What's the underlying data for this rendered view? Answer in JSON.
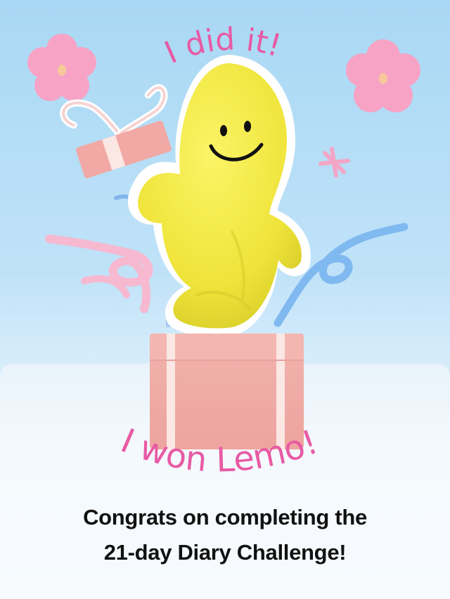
{
  "celebration": {
    "top_text": "I did it!",
    "bottom_text": "I won Lemo!",
    "caption_line1": "Congrats on completing the",
    "caption_line2": "21-day Diary Challenge!"
  },
  "colors": {
    "sky": "#b8def6",
    "panel": "#f4f9fd",
    "flower": "#f7a3c6",
    "flower_center": "#f6c89a",
    "gift_box": "#f2a8a4",
    "ribbon": "#fbe7e3",
    "lemo_body": "#f3ea3f",
    "hand_text": "#e85aa4",
    "caption_text": "#111111"
  },
  "icons": {
    "flower_left": "flower-icon",
    "flower_right": "flower-icon",
    "sparkle": "star-sparkle-icon",
    "gift": "gift-box-icon",
    "mascot": "lemo-plush-mascot"
  }
}
